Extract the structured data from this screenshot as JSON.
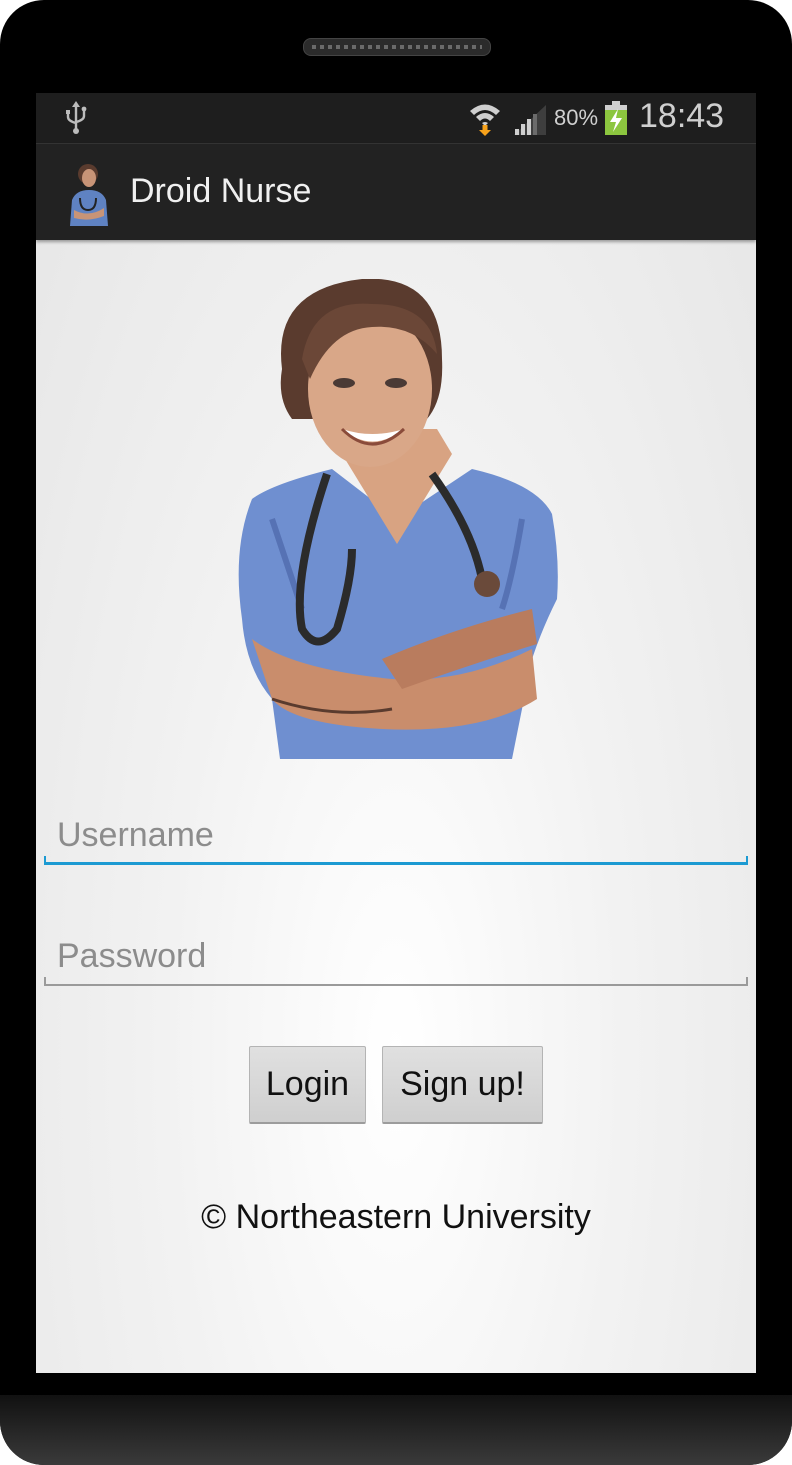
{
  "status_bar": {
    "battery_percent": "80%",
    "time": "18:43",
    "icons": [
      "usb-icon",
      "wifi-icon",
      "signal-icon",
      "battery-charging-icon"
    ]
  },
  "action_bar": {
    "title": "Droid Nurse",
    "icon": "nurse-app-icon"
  },
  "main": {
    "hero_image": "nurse-illustration",
    "username": {
      "placeholder": "Username",
      "value": ""
    },
    "password": {
      "placeholder": "Password",
      "value": ""
    },
    "login_label": "Login",
    "signup_label": "Sign up!",
    "footer": "© Northeastern University"
  },
  "colors": {
    "accent": "#1c9ad2",
    "action_bar": "#222222",
    "status_bar": "#1e1e1e",
    "battery_green": "#8cc63f"
  }
}
